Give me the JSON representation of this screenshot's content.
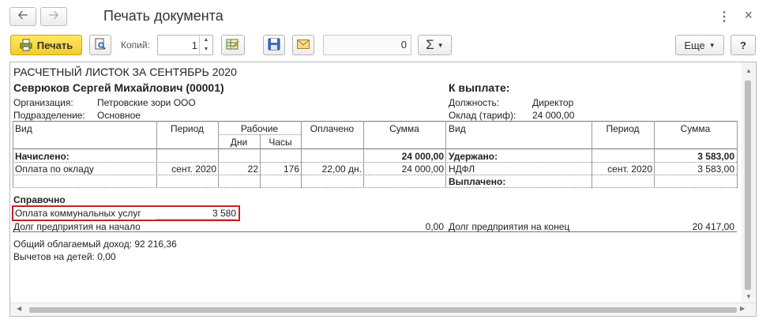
{
  "window": {
    "title": "Печать документа"
  },
  "toolbar": {
    "print_label": "Печать",
    "copies_label": "Копий:",
    "copies_value": "1",
    "sum_value": "0",
    "sigma_label": "Σ",
    "more_label": "Еще",
    "help_label": "?"
  },
  "doc": {
    "title": "РАСЧЕТНЫЙ ЛИСТОК ЗА СЕНТЯБРЬ 2020",
    "employee": "Севрюков Сергей Михайлович (00001)",
    "to_pay_label": "К выплате:",
    "org_label": "Организация:",
    "org_value": "Петровские зори ООО",
    "dept_label": "Подразделение:",
    "dept_value": "Основное",
    "position_label": "Должность:",
    "position_value": "Директор",
    "salary_label": "Оклад (тариф):",
    "salary_value": "24 000,00",
    "headers": {
      "vid": "Вид",
      "period": "Период",
      "working": "Рабочие",
      "days": "Дни",
      "hours": "Часы",
      "paid": "Оплачено",
      "sum": "Сумма",
      "vid_right": "Вид",
      "period_right": "Период",
      "sum_right": "Сумма"
    },
    "accrued_label": "Начислено:",
    "accrued_total": "24 000,00",
    "withheld_label": "Удержано:",
    "withheld_total": "3 583,00",
    "accrual_row": {
      "vid": "Оплата по окладу",
      "period": "сент. 2020",
      "days": "22",
      "hours": "176",
      "paid": "22,00 дн.",
      "sum": "24 000,00"
    },
    "withheld_row": {
      "vid": "НДФЛ",
      "period": "сент. 2020",
      "sum": "3 583,00"
    },
    "paid_out_label": "Выплачено:",
    "reference_label": "Справочно",
    "utility_label": "Оплата коммунальных услуг",
    "utility_value": "3 580",
    "debt_start_label": "Долг предприятия на начало",
    "debt_start_value": "0,00",
    "debt_end_label": "Долг предприятия на конец",
    "debt_end_value": "20 417,00",
    "taxable_income": "Общий облагаемый доход: 92 216,36",
    "child_deductions": "Вычетов на детей: 0,00"
  },
  "colors": {
    "print_button": "#f3cc24",
    "highlight_box": "#cc1f1f"
  },
  "icons": [
    "arrow-left-icon",
    "arrow-right-icon",
    "more-vert-icon",
    "close-icon",
    "printer-icon",
    "print-preview-icon",
    "edit-table-icon",
    "save-icon",
    "email-icon"
  ]
}
